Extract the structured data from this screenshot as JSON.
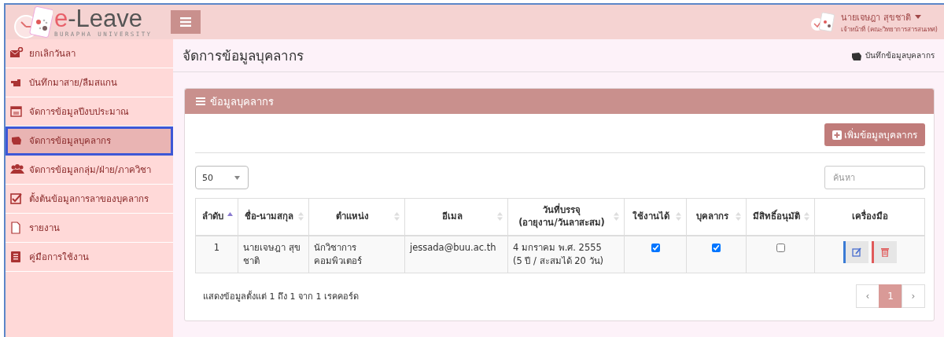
{
  "header": {
    "logo": {
      "prefix": "e",
      "name": "-Leave",
      "subtitle": "BURAPHA UNIVERSITY"
    },
    "user": {
      "name": "นายเจษฎา สุขชาติ",
      "role": "เจ้าหน้าที่ (คณะวิทยาการสารสนเทศ)"
    }
  },
  "sidebar": {
    "items": [
      {
        "label": "ยกเลิกวันลา",
        "selected": false
      },
      {
        "label": "บันทึกมาสาย/ลืมสแกน",
        "selected": false
      },
      {
        "label": "จัดการข้อมูลปีงบประมาณ",
        "selected": false
      },
      {
        "label": "จัดการข้อมูลบุคลากร",
        "selected": true
      },
      {
        "label": "จัดการข้อมูลกลุ่ม/ฝ่าย/ภาควิชา",
        "selected": false
      },
      {
        "label": "ตั้งต้นข้อมูลการลาของบุคลากร",
        "selected": false
      },
      {
        "label": "รายงาน",
        "selected": false
      },
      {
        "label": "คู่มือการใช้งาน",
        "selected": false
      }
    ]
  },
  "page": {
    "title": "จัดการข้อมูลบุคลากร",
    "breadcrumb": "บันทึกข้อมูลบุคลากร"
  },
  "panel": {
    "title": "ข้อมูลบุคลากร",
    "add_button": "เพิ่มข้อมูลบุคลากร",
    "page_size": "50",
    "search": {
      "placeholder": "ค้นหา"
    },
    "table": {
      "columns": [
        {
          "lines": [
            "ลำดับ"
          ],
          "sortable": true,
          "sorted": true
        },
        {
          "lines": [
            "ชื่อ-นามสกุล"
          ],
          "sortable": true,
          "sorted": false
        },
        {
          "lines": [
            "ตำแหน่ง"
          ],
          "sortable": true,
          "sorted": false
        },
        {
          "lines": [
            "อีเมล"
          ],
          "sortable": true,
          "sorted": false
        },
        {
          "lines": [
            "วันที่บรรจุ",
            "(อายุงาน/วันลาสะสม)"
          ],
          "sortable": true,
          "sorted": false
        },
        {
          "lines": [
            "ใช้งานได้"
          ],
          "sortable": true,
          "sorted": false
        },
        {
          "lines": [
            "บุคลากร"
          ],
          "sortable": true,
          "sorted": false
        },
        {
          "lines": [
            "มีสิทธิ์อนุมัติ"
          ],
          "sortable": true,
          "sorted": false
        },
        {
          "lines": [
            "เครื่องมือ"
          ],
          "sortable": false
        }
      ],
      "rows": [
        {
          "cells": [
            {
              "kind": "number",
              "lines": [
                "1"
              ]
            },
            {
              "kind": "text",
              "lines": [
                "นายเจษฎา สุข",
                "ชาติ"
              ]
            },
            {
              "kind": "text",
              "lines": [
                "นักวิชาการ",
                "คอมพิวเตอร์"
              ]
            },
            {
              "kind": "text",
              "lines": [
                "jessada@buu.ac.th"
              ]
            },
            {
              "kind": "text",
              "lines": [
                "4 มกราคม พ.ศ. 2555",
                "(5 ปี / สะสมได้ 20 วัน)"
              ]
            },
            {
              "kind": "check",
              "checked": true
            },
            {
              "kind": "check",
              "checked": true
            },
            {
              "kind": "check",
              "checked": false
            },
            {
              "kind": "actions"
            }
          ]
        }
      ]
    },
    "info": "แสดงข้อมูลตั้งแต่ 1 ถึง 1 จาก 1 เรคคอร์ด",
    "pagination": [
      {
        "label": "‹",
        "selected": false
      },
      {
        "label": "1",
        "selected": true
      },
      {
        "label": "›",
        "selected": false
      }
    ]
  }
}
